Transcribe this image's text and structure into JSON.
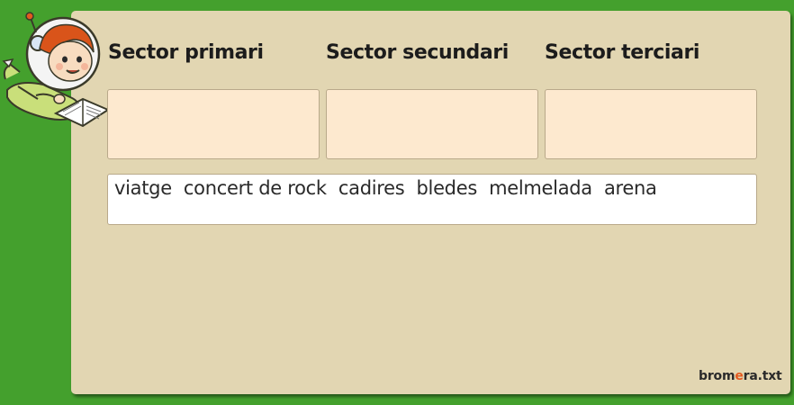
{
  "columns": [
    {
      "header": "Sector primari"
    },
    {
      "header": "Sector secundari"
    },
    {
      "header": "Sector terciari"
    }
  ],
  "word_bank": [
    "viatge",
    "concert de rock",
    "cadires",
    "bledes",
    "melmelada",
    "arena"
  ],
  "logo": {
    "part1": "brom",
    "accent": "e",
    "part2": "ra.txt"
  },
  "colors": {
    "background": "#44a02d",
    "panel": "#e2d6b2",
    "dropbox": "#fde9cf",
    "logo_accent": "#e35a1f"
  },
  "mascot": {
    "icon": "astronaut-girl-reading-icon"
  }
}
